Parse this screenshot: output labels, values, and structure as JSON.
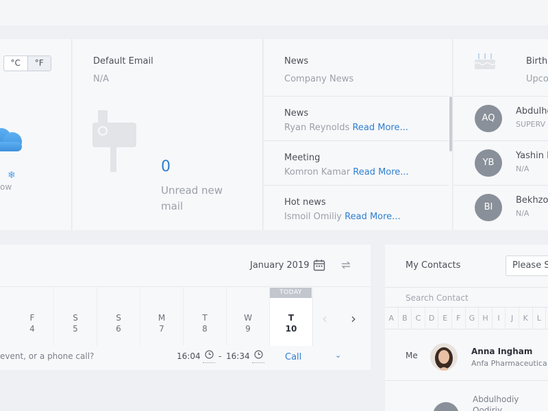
{
  "weather": {
    "units": [
      "°C",
      "°F"
    ],
    "label": "ow"
  },
  "email": {
    "title": "Default Email",
    "value": "N/A",
    "count": "0",
    "label": "Unread new mail"
  },
  "news": {
    "title": "News",
    "subtitle": "Company News",
    "read_more": "Read More...",
    "items": [
      {
        "title": "News",
        "author": "Ryan Reynolds"
      },
      {
        "title": "Meeting",
        "author": "Komron Kamar"
      },
      {
        "title": "Hot news",
        "author": "Ismoil Omiliy"
      }
    ]
  },
  "birthdays": {
    "title": "Birth",
    "subtitle": "Upco",
    "people": [
      {
        "initials": "AQ",
        "name": "Abdulho",
        "role": "SUPERV"
      },
      {
        "initials": "YB",
        "name": "Yashin E",
        "role": "N/A"
      },
      {
        "initials": "BI",
        "name": "Bekhzo",
        "role": "N/A"
      }
    ]
  },
  "calendar": {
    "month": "January 2019",
    "today_badge": "TODAY",
    "days": [
      {
        "letter": "F",
        "num": "4"
      },
      {
        "letter": "S",
        "num": "5"
      },
      {
        "letter": "S",
        "num": "6"
      },
      {
        "letter": "M",
        "num": "7"
      },
      {
        "letter": "T",
        "num": "8"
      },
      {
        "letter": "W",
        "num": "9"
      },
      {
        "letter": "T",
        "num": "10"
      }
    ],
    "call_placeholder": "event, or a phone call?",
    "time_from": "16:04",
    "time_sep": "-",
    "time_to": "16:34",
    "call_type": "Call"
  },
  "contacts": {
    "title": "My Contacts",
    "select_placeholder": "Please Se",
    "search_placeholder": "Search Contact",
    "letters": [
      "A",
      "B",
      "C",
      "D",
      "E",
      "F",
      "G",
      "H",
      "I",
      "J",
      "K",
      "L",
      "M"
    ],
    "me_label": "Me",
    "me_name": "Anna Ingham",
    "me_company": "Anfa Pharmaceutica",
    "next_name": "Abdulhodiy Qodiriy"
  },
  "colors": {
    "accent": "#2f7fd0",
    "avatar_grey": "#8a9099",
    "cloud": "#4fa3ea"
  },
  "icons": [
    "cloud-icon",
    "snowflake-icon",
    "mailbox-icon",
    "cake-icon",
    "calendar-icon",
    "sync-icon",
    "clock-icon",
    "chevron-left-icon",
    "chevron-right-icon",
    "chevron-down-icon"
  ]
}
